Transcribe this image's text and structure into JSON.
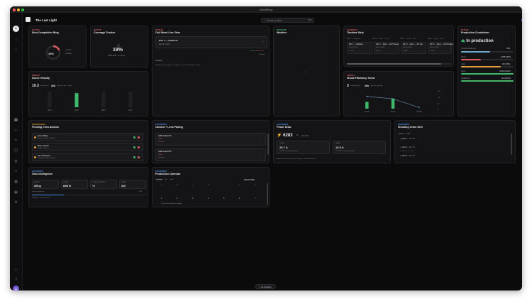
{
  "window": {
    "title": "ClientFlow"
  },
  "app": {
    "title": "The Last Light",
    "avatar": "JM"
  },
  "search": {
    "placeholder": "Search project…",
    "shortcut": "⌘K"
  },
  "widgets_pill": "+ 14 widgets",
  "colors": {
    "status": "#e25b5b",
    "weather": "#3fb86a",
    "insight": "#e25b5b",
    "operational": "#e29b3c",
    "equipment": "#4d8fe8"
  },
  "shot_ring": {
    "category": "STATUS",
    "title": "Shot Completion Ring",
    "percent": "19%",
    "legend_1": "3 left",
    "legend_2": "Shots"
  },
  "coverage": {
    "category": "STATUS",
    "title": "Coverage Tracker",
    "percent": "19%",
    "sub": "22/58 shots · 4 scenes"
  },
  "callsheet": {
    "category": "STATUS",
    "title": "Call Sheet Live View",
    "day": "DAY 1 — Callsheet",
    "date": "Mar 18, 2026",
    "legend_a": "Shots 3",
    "legend_b": "Scenes 10",
    "foot": "0 breaks",
    "section": "Timeline",
    "empty": "No shots scheduled for this day yet — open the Call sheet editor."
  },
  "weather": {
    "category": "WEATHER",
    "title": "Weather"
  },
  "timeline": {
    "category": "SCHEDULE",
    "title": "Timeline Strip",
    "cols": [
      {
        "label": "DAY 1 — Callsheet",
        "date": "Mar 18, 2026",
        "foot": "0 shots"
      },
      {
        "label": "DAY 2 — Day 2 — EXT Streets",
        "date": "Mar 19, 2026",
        "foot": "0 shots"
      },
      {
        "label": "DAY 3 — Day 3 — INT Lab",
        "date": "Mar 20, 2026",
        "foot": "0 shots"
      },
      {
        "label": "DAY 4 — Day 4 — EXT Rooftop",
        "date": "Mar 21, 2026",
        "foot": "0 shots"
      }
    ],
    "heads": [
      "DAY 1 — Callsheet",
      "DAY 2 — Day 2 — EXT...",
      "DAY 3 — Day 3 — INT...",
      "DAY 4 — Day 4 — EXT..."
    ]
  },
  "countdown": {
    "category": "STATUS",
    "title": "Production Countdown",
    "status": "In production",
    "rows": [
      {
        "label": "Overall Readiness",
        "value": "56%"
      },
      {
        "label": "Shots",
        "value": "22/58 (38%)"
      },
      {
        "label": "Crew",
        "value": "6/8 (75%)"
      },
      {
        "label": "Gear",
        "value": "32/32 (100%)"
      },
      {
        "label": "Callsheets",
        "value": "4/4 (100%)"
      }
    ]
  },
  "velocity": {
    "category": "INSIGHT",
    "title": "Scene Velocity",
    "big": "19.3",
    "big_unit": "shots/week",
    "sub_value": "26d",
    "sub_text": "days per shot · 4 days",
    "labels": [
      "Wk 1",
      "Wk 2",
      "Wk 3",
      "Wk 4"
    ]
  },
  "efficiency": {
    "category": "INSIGHT",
    "title": "Shoot Efficiency Trend",
    "a": "3",
    "a_text": "shots/day avg",
    "b": "39s",
    "b_text": "avg shots per day",
    "labels": [
      "D1 18",
      "D2 19",
      "D3 20"
    ],
    "y": [
      "150",
      "100",
      "50",
      "0"
    ]
  },
  "chart_data": [
    {
      "type": "bar",
      "categories": [
        "Wk 1",
        "Wk 2",
        "Wk 3",
        "Wk 4"
      ],
      "values": [
        0,
        18,
        0,
        0
      ],
      "ylim": [
        0,
        20
      ]
    },
    {
      "type": "bar",
      "categories": [
        "D1 18",
        "D2 19",
        "D3 20"
      ],
      "values": [
        55,
        82,
        0
      ],
      "ylim": [
        0,
        150
      ],
      "line_values": [
        100,
        80,
        10
      ]
    }
  ],
  "crew": {
    "category": "OPERATIONAL",
    "title": "Pending Crew Actions",
    "rows": [
      {
        "name": "Emma Blake",
        "role": "Director of Photo · 1000 mi"
      },
      {
        "name": "Mike Johnson",
        "role": "1st AD · 1000 mi"
      },
      {
        "name": "Sam Rodriguez",
        "role": "Sound Recordist · 1000 mi"
      }
    ]
  },
  "camera": {
    "category": "EQUIPMENT",
    "title": "Camera + Lens Pairing",
    "rows": [
      {
        "name": "ARRI ALEXA 35",
        "state": "Offline",
        "lens": "0 lenses"
      },
      {
        "name": "ARRI ALEXA 35",
        "state": "Offline",
        "lens": "0 lenses"
      }
    ]
  },
  "power": {
    "category": "EQUIPMENT",
    "title": "Power Draw",
    "value": "6283",
    "unit": "W",
    "tag": "(52.3 kW)",
    "boxes": [
      {
        "label": "TOTAL",
        "value": "26.7 A",
        "sub": "of 60 A circuit capacity (44%)"
      },
      {
        "label": "DRAW",
        "value": "16.5 A",
        "sub": "of 100 A circuit capacity (16%)"
      }
    ],
    "note": "Estimate based on item power ratings — actual draw varies."
  },
  "shooting": {
    "category": "EQUIPMENT",
    "title": "Shooting Order Grid",
    "head": "▾ Shoot · 6 left",
    "rows": [
      {
        "label": "DAY 1",
        "sub": "Mar 18"
      },
      {
        "label": "DAY 2",
        "sub": "Mar 19"
      },
      {
        "label": "DAY 3",
        "sub": "Mar 20"
      }
    ],
    "caption": "Shoot Mar 18 – Mar 21"
  },
  "gear": {
    "category": "EQUIPMENT",
    "title": "Gear Intelligence",
    "boxes": [
      {
        "label": "WEIGHT",
        "value": "268 kg"
      },
      {
        "label": "POWER",
        "value": "6283 W"
      },
      {
        "label": "CONFLICTS/RISKS",
        "value": "+3"
      },
      {
        "label": "CASES",
        "value": "0/32"
      }
    ],
    "bar_label": "Gear checked out",
    "bar_value": "28%",
    "foot": "6 booked · 3 needs return"
  },
  "calendar": {
    "category": "EQUIPMENT",
    "title": "Production Calendar",
    "chips": [
      "Calendar",
      "Day",
      "Week"
    ],
    "month": "March 2026",
    "dows": [
      "S",
      "M",
      "T",
      "W",
      "T",
      "F",
      "S"
    ],
    "days": [
      "1",
      "2",
      "3",
      "4",
      "5",
      "6",
      "7"
    ],
    "legend": [
      "Shoot",
      "Prep",
      "Wrap",
      "Holiday"
    ]
  }
}
